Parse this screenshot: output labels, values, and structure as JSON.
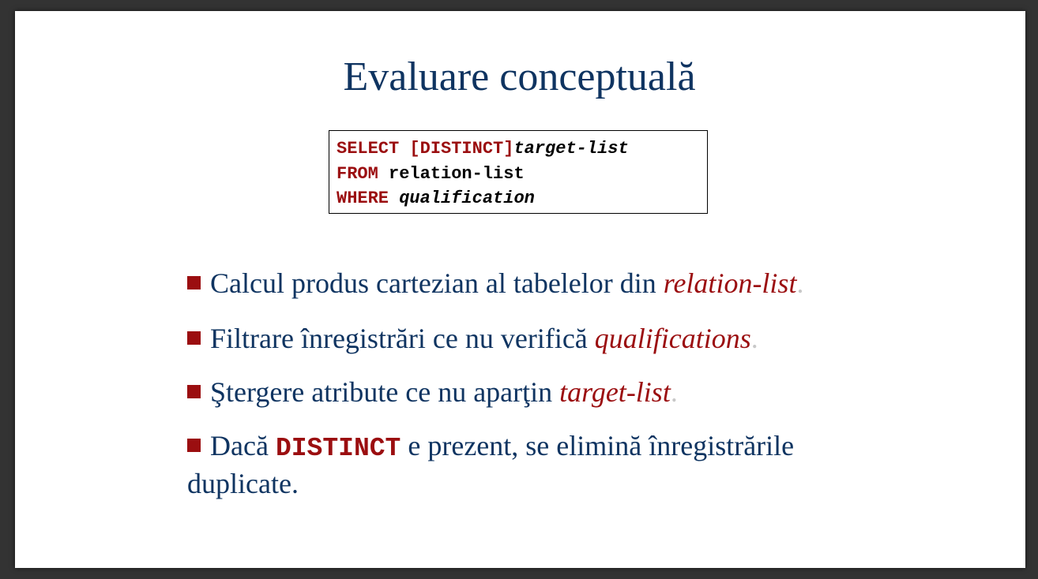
{
  "slide": {
    "title": "Evaluare conceptuală",
    "code": {
      "line1": {
        "kw1": "SELECT",
        "kw2": "[DISTINCT]",
        "rest": "target-list"
      },
      "line2": {
        "kw": "FROM",
        "rest": "relation-list"
      },
      "line3": {
        "kw": "WHERE",
        "rest": "qualification"
      }
    },
    "bullets": [
      {
        "text": "Calcul produs cartezian al tabelelor din ",
        "emphasis": "relation-list",
        "tail": "."
      },
      {
        "text": "Filtrare înregistrări ce nu verifică ",
        "emphasis": "qualifications",
        "tail": "."
      },
      {
        "text": "Ştergere atribute ce nu aparţin ",
        "emphasis": "target-list",
        "tail": "."
      },
      {
        "text_before": "Dacă ",
        "keyword": "DISTINCT",
        "text_after": " e prezent, se elimină înregistrările duplicate."
      }
    ]
  },
  "colors": {
    "title": "#0f3461",
    "accent": "#9b0e10",
    "background": "#333333"
  }
}
